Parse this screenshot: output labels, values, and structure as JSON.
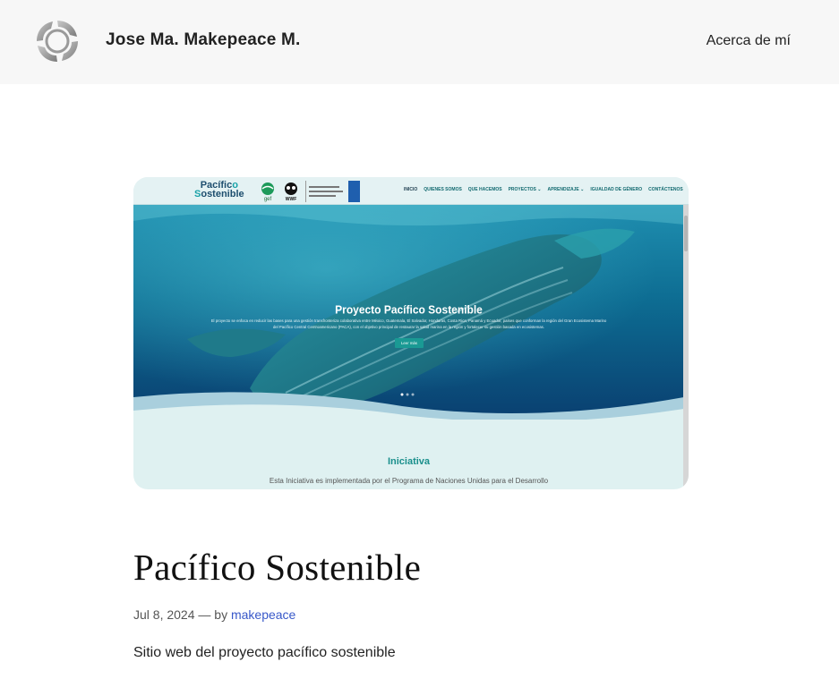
{
  "header": {
    "logo_icon": "circular-arrows-logo-icon",
    "site_title": "Jose Ma. Makepeace M.",
    "nav": [
      {
        "label": "Acerca de mí"
      }
    ]
  },
  "featured_image": {
    "nav": {
      "logo_line1_a": "Pacífic",
      "logo_line1_b": "o",
      "logo_line2_a": "S",
      "logo_line2_b": "ostenible",
      "partners": [
        "gef",
        "WWF"
      ],
      "menu": [
        "INICIO",
        "QUIENES SOMOS",
        "QUE HACEMOS",
        "PROYECTOS ⌄",
        "APRENDIZAJE ⌄",
        "IGUALDAD DE GÉNERO",
        "CONTÁCTENOS"
      ]
    },
    "hero": {
      "title": "Proyecto Pacífico Sostenible",
      "text": "El proyecto se enfoca en reducir las bases para una gestión transfronteriza colaborativa entre México, Guatemala, El Salvador, Honduras, Costa Rica, Panamá y Ecuador, países que conforman la región del Gran Ecosistema Marino del Pacífico Central Centroamericano (PACA), con el objetivo principal de restaurar la salud marina en la región y fortalecer su gestión basada en ecosistemas.",
      "button": "Leer más"
    },
    "section": {
      "title": "Iniciativa",
      "text": "Esta Iniciativa es implementada por el Programa de Naciones Unidas para el Desarrollo"
    }
  },
  "post": {
    "title": "Pacífico Sostenible",
    "date": "Jul 8, 2024",
    "separator": "— by",
    "author": "makepeace",
    "excerpt": "Sitio web del proyecto pacífico sostenible"
  }
}
